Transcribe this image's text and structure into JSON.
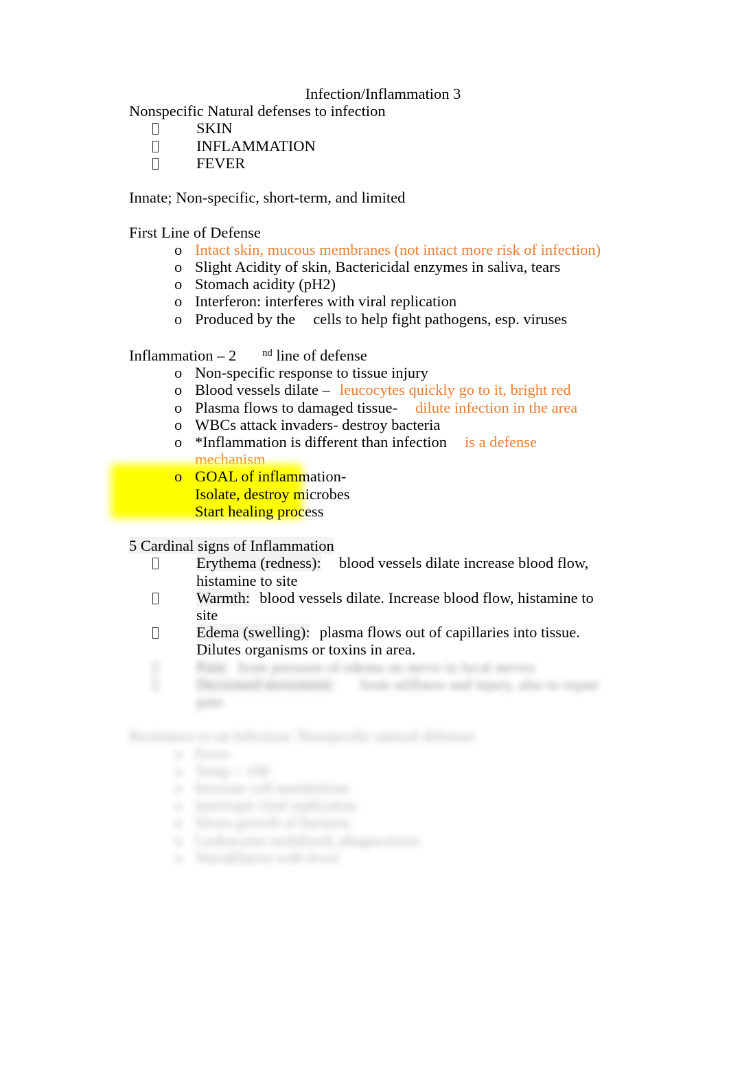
{
  "document": {
    "title": "Infection/Inflammation 3",
    "colors": {
      "orange_accent": "#ED7D31",
      "highlight_yellow": "#FFFF00",
      "text": "#000000",
      "shade_gray": "#F2F2F2",
      "page_background": "#FFFFFF"
    },
    "bullet_glyph_name": "missing-glyph-box",
    "sections": [
      {
        "heading": "Nonspecific Natural defenses to infection",
        "items": [
          "SKIN",
          "INFLAMMATION",
          "FEVER"
        ]
      }
    ],
    "innate_line": "Innate; Non-specific, short-term, and limited",
    "first_line_of_defense": {
      "heading": "First Line of Defense",
      "items": [
        {
          "text": "Intact skin, mucous membranes (not intact more risk of infection)",
          "color": "orange"
        },
        {
          "text": "Slight Acidity of skin, Bactericidal enzymes in saliva, tears",
          "color": "black"
        },
        {
          "text": "Stomach acidity (pH2)",
          "color": "black"
        },
        {
          "text": "Interferon: interferes with viral replication",
          "color": "black"
        },
        {
          "prefix": "Produced by the",
          "suffix": "cells to help fight pathogens, esp. viruses",
          "color": "black"
        }
      ]
    },
    "inflammation": {
      "heading_prefix": "Inflammation – 2",
      "heading_sup": "nd",
      "heading_suffix": "line of defense",
      "items": [
        {
          "black": "Non-specific response to tissue injury",
          "orange": ""
        },
        {
          "black": "Blood vessels dilate –",
          "orange": "leucocytes quickly go to it, bright red"
        },
        {
          "black": "Plasma flows to damaged tissue-",
          "orange": "dilute infection in the area"
        },
        {
          "black": "WBCs attack invaders- destroy bacteria",
          "orange": ""
        },
        {
          "black": "*Inflammation is different than infection",
          "orange": "is a defense mechanism"
        }
      ],
      "goal_highlighted": {
        "line1": "GOAL of inflammation-",
        "line2": "Isolate, destroy microbes",
        "line3": "Start healing process"
      }
    },
    "cardinal_signs": {
      "heading": "5 Cardinal signs of Inflammation",
      "items": [
        {
          "term": "Erythema (redness):",
          "desc": "blood vessels dilate increase blood flow, histamine to site"
        },
        {
          "term": "Warmth:",
          "desc": "blood vessels dilate. Increase blood flow, histamine to site"
        },
        {
          "term": "Edema (swelling):",
          "desc": "plasma flows out of capillaries into tissue. Dilutes organisms or toxins in area."
        },
        {
          "term": "Pain:",
          "desc": "from pressure of edema on nerve in local nerves"
        },
        {
          "term": "Decreased movement:",
          "desc": "from stiffness and injury, also to repair pain"
        }
      ]
    },
    "resistance": {
      "heading": "Resistance to an Infection: Nonspecific natural defenses",
      "items": [
        "Fever",
        "Temp > 100",
        "Increase cell metabolism",
        "Interrupts viral replication",
        "Slows growth of bacteria",
        "Leukocytes mobilized, phagocytosis",
        "Vasodilation with fever"
      ]
    }
  }
}
